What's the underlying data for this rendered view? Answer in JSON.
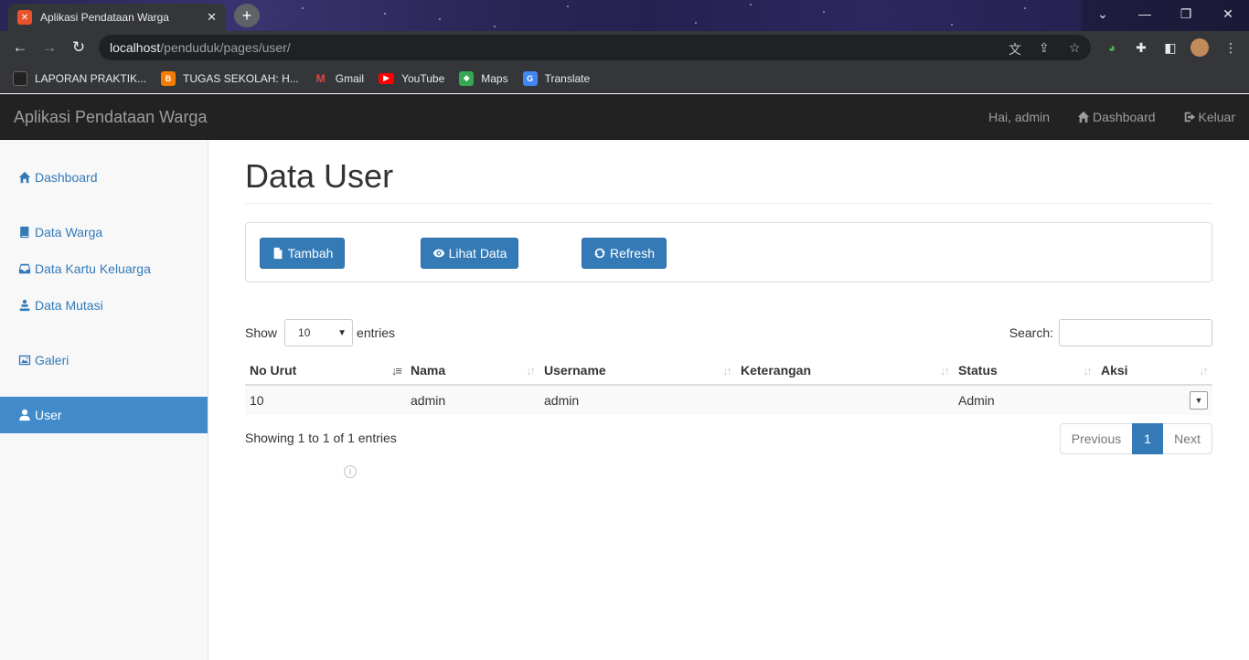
{
  "browser": {
    "tab_title": "Aplikasi Pendataan Warga",
    "url_host": "localhost",
    "url_path": "/penduduk/pages/user/",
    "bookmarks": [
      {
        "label": "LAPORAN PRAKTIK...",
        "color": "#222222"
      },
      {
        "label": "TUGAS SEKOLAH: H...",
        "color": "#f57c00"
      },
      {
        "label": "Gmail",
        "color": "#ea4335"
      },
      {
        "label": "YouTube",
        "color": "#ff0000"
      },
      {
        "label": "Maps",
        "color": "#34a853"
      },
      {
        "label": "Translate",
        "color": "#4285f4"
      }
    ]
  },
  "appbar": {
    "brand": "Aplikasi Pendataan Warga",
    "greeting": "Hai, admin",
    "dashboard": "Dashboard",
    "logout": "Keluar"
  },
  "sidebar": {
    "items": [
      {
        "label": "Dashboard",
        "icon": "home-icon"
      },
      {
        "label": "Data Warga",
        "icon": "book-icon"
      },
      {
        "label": "Data Kartu Keluarga",
        "icon": "inbox-icon"
      },
      {
        "label": "Data Mutasi",
        "icon": "person-move-icon"
      },
      {
        "label": "Galeri",
        "icon": "picture-icon"
      },
      {
        "label": "User",
        "icon": "user-icon",
        "active": true
      }
    ]
  },
  "main": {
    "title": "Data User",
    "buttons": {
      "add": "Tambah",
      "view": "Lihat Data",
      "refresh": "Refresh"
    },
    "length": {
      "show": "Show",
      "value": "10",
      "entries": "entries"
    },
    "search_label": "Search:",
    "table": {
      "columns": [
        "No Urut",
        "Nama",
        "Username",
        "Keterangan",
        "Status",
        "Aksi"
      ],
      "rows": [
        {
          "no": "10",
          "nama": "admin",
          "username": "admin",
          "keterangan": "",
          "status": "Admin"
        }
      ]
    },
    "info": "Showing 1 to 1 of 1 entries",
    "pagination": {
      "prev": "Previous",
      "current": "1",
      "next": "Next"
    }
  }
}
